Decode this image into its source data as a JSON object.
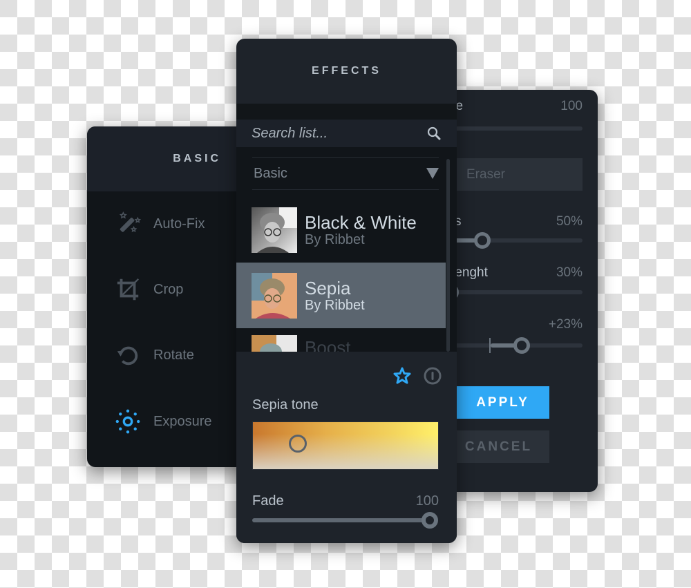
{
  "basic_panel": {
    "title": "BASIC",
    "tools": [
      {
        "label": "Auto-Fix",
        "icon": "magic-wand-icon",
        "active": false
      },
      {
        "label": "Crop",
        "icon": "crop-icon",
        "active": false
      },
      {
        "label": "Rotate",
        "icon": "rotate-icon",
        "active": false
      },
      {
        "label": "Exposure",
        "icon": "sun-icon",
        "active": true
      }
    ]
  },
  "brush_panel": {
    "size_label": "ze",
    "size_value": "100",
    "mode_label": "Eraser",
    "hardness_label": "s",
    "hardness_value": "50%",
    "hardness_fraction": 0.18,
    "strength_label": "renght",
    "strength_value": "30%",
    "strength_fraction": 0.0,
    "offset_value": "+23%",
    "offset_fraction": 0.45,
    "apply_label": "APPLY",
    "cancel_label": "CANCEL"
  },
  "effects_panel": {
    "title": "EFFECTS",
    "search": {
      "placeholder": "Search list...",
      "value": ""
    },
    "category": "Basic",
    "items": [
      {
        "name": "Black & White",
        "by": "By Ribbet",
        "selected": false
      },
      {
        "name": "Sepia",
        "by": "By Ribbet",
        "selected": true
      },
      {
        "name": "Boost",
        "by": "",
        "selected": false
      }
    ],
    "detail": {
      "tone_label": "Sepia tone",
      "fade_label": "Fade",
      "fade_value": "100",
      "fade_fraction": 1.0,
      "favorite_icon": "star-icon",
      "info_icon": "info-icon"
    }
  },
  "colors": {
    "accent": "#2fa8f5",
    "panel_bg": "#1e232a",
    "selected_row": "#5b656f"
  }
}
